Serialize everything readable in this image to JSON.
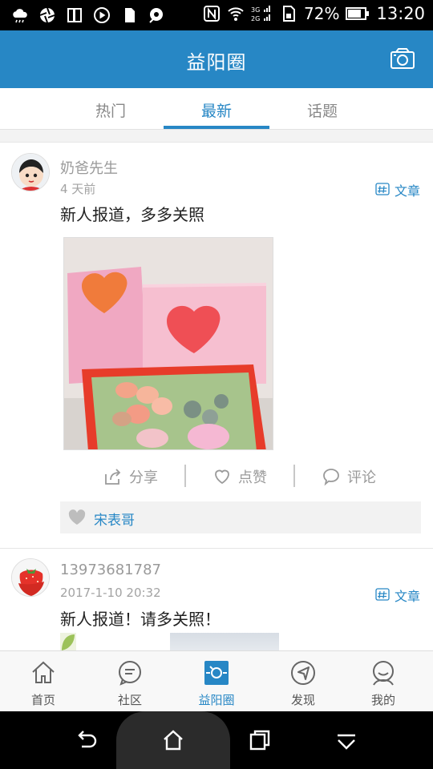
{
  "status_bar": {
    "battery": "72%",
    "time": "13:20",
    "network": "3G 2G"
  },
  "app_bar": {
    "title": "益阳圈",
    "camera_icon": "camera-icon"
  },
  "tabs": [
    {
      "label": "热门",
      "active": false
    },
    {
      "label": "最新",
      "active": true
    },
    {
      "label": "话题",
      "active": false
    }
  ],
  "posts": [
    {
      "author": "奶爸先生",
      "time": "4 天前",
      "type": "文章",
      "content": "新人报道，多多关照",
      "has_photo": true,
      "actions": {
        "share": "分享",
        "like": "点赞",
        "comment": "评论"
      },
      "liked_by": "宋表哥"
    },
    {
      "author": "13973681787",
      "time": "2017-1-10 20:32",
      "type": "文章",
      "content": "新人报道！请多关照！"
    }
  ],
  "bottom_nav": [
    {
      "label": "首页",
      "icon": "home-icon",
      "active": false
    },
    {
      "label": "社区",
      "icon": "chat-bubble-icon",
      "active": false
    },
    {
      "label": "益阳圈",
      "icon": "camera-circle-icon",
      "active": true
    },
    {
      "label": "发现",
      "icon": "compass-icon",
      "active": false
    },
    {
      "label": "我的",
      "icon": "person-icon",
      "active": false
    }
  ],
  "colors": {
    "primary": "#2787c5",
    "status_bar": "#000000",
    "text_dark": "#222222",
    "text_muted": "#9a9a9a"
  }
}
